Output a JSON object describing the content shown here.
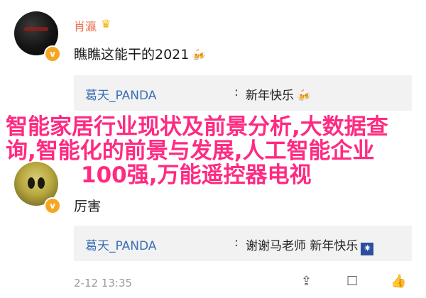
{
  "comments": [
    {
      "username": "肖瀛",
      "text": "瞧瞧这能干的2021",
      "text_emoji": "🍻",
      "reply": {
        "user": "葛天_PANDA",
        "sep": ":",
        "text": "新年快乐",
        "emoji": "🍻"
      }
    },
    {
      "username": "",
      "text": "厉害",
      "reply": {
        "user": "葛天_PANDA",
        "sep": ":",
        "text": "谢谢马老师 新年快乐",
        "emoji": "✷"
      },
      "timestamp": "2-12 13:35"
    }
  ],
  "icons": {
    "verified": "v",
    "crown": "♛",
    "share": "⇪",
    "comment": "☐",
    "like": "👍"
  },
  "overlay": {
    "line1": "智能家居行业现状及前景分析,大数据查",
    "line2": "询,智能化的前景与发展,人工智能企业",
    "line3": "100强,万能遥控器电视"
  },
  "colors": {
    "username": "#eb7350",
    "reply_user": "#3b6fb6",
    "overlay_text": "#ff2a82",
    "badge": "#f5a623"
  }
}
